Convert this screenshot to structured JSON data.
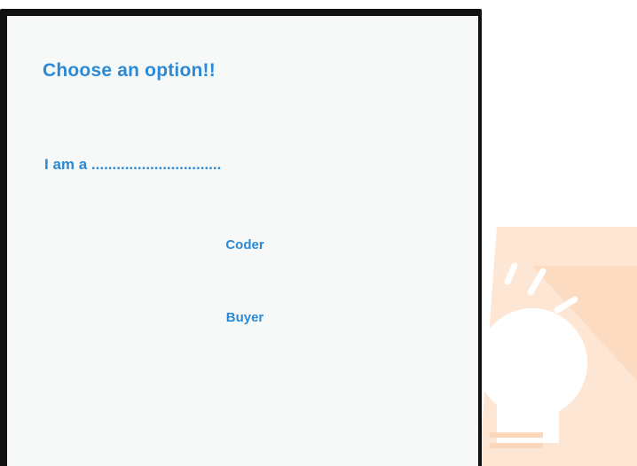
{
  "colors": {
    "accent": "#2a8ad6",
    "screen_background": "#f7f8f8",
    "watermark": "#fbdcc4"
  },
  "decoration": {
    "watermark_icon": "lightbulb-icon"
  },
  "screen": {
    "title": "Choose an option!!",
    "prompt": "I am a ...............................",
    "options": [
      {
        "label": "Coder"
      },
      {
        "label": "Buyer"
      }
    ]
  }
}
